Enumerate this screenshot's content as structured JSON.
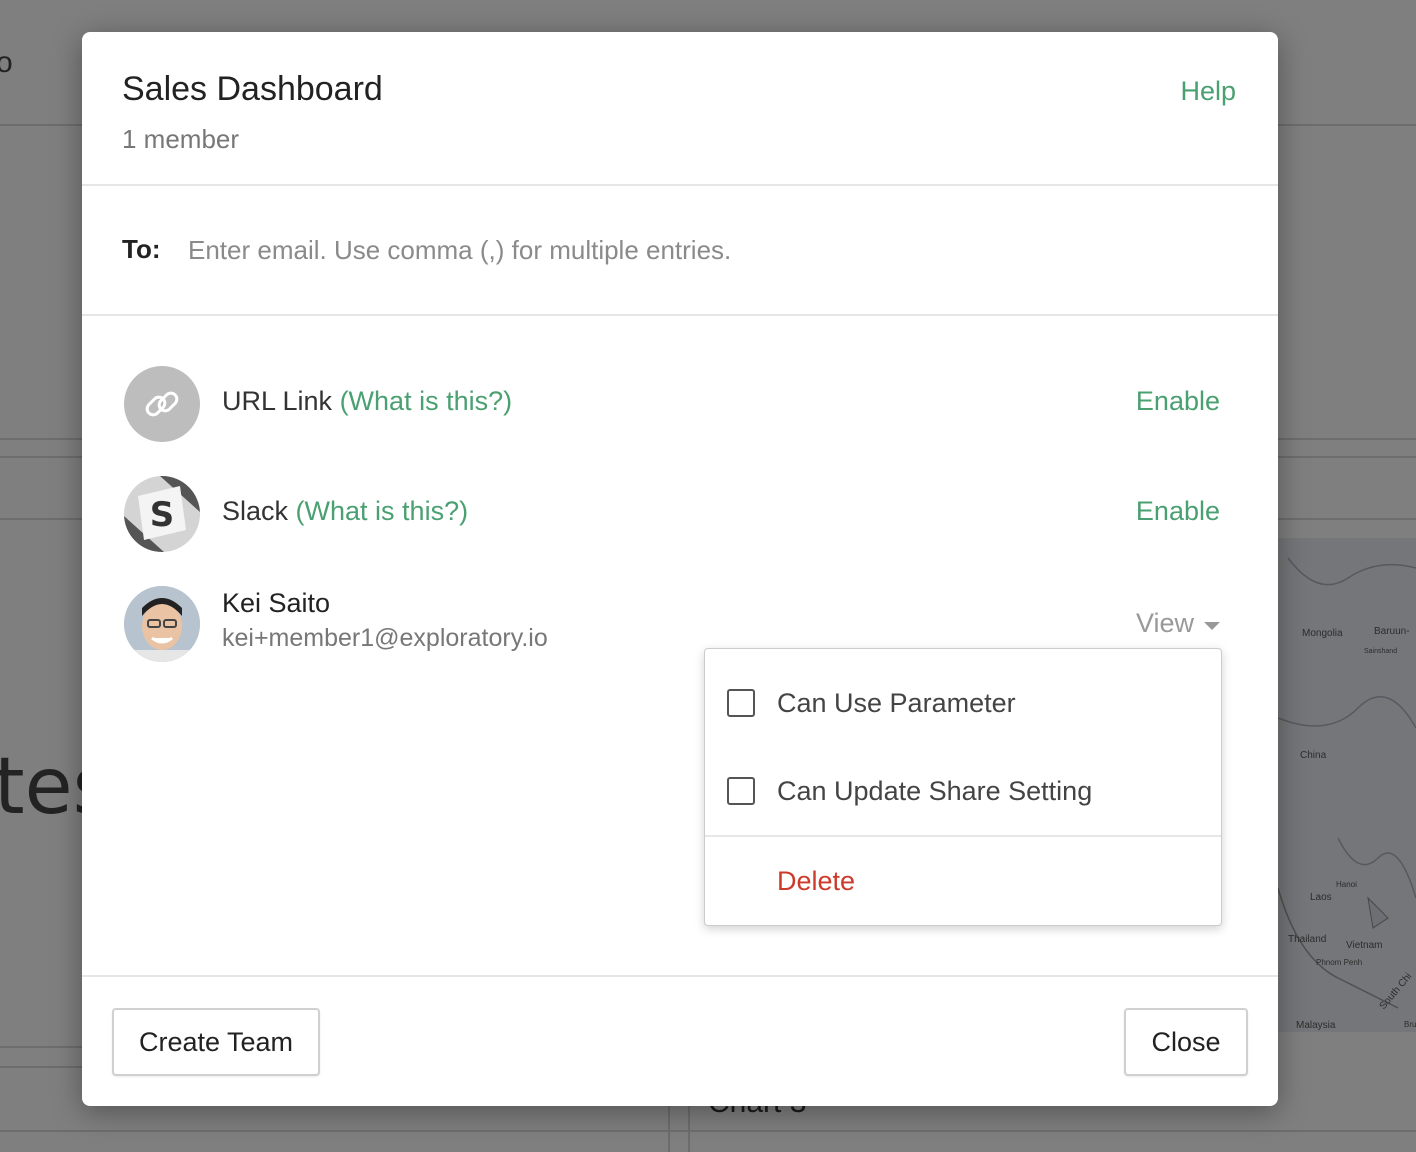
{
  "background": {
    "partial_heading": "tes",
    "partial_glyph": "o",
    "chart_label": "Chart 3",
    "map_labels": [
      "Mongolia",
      "Baruun-",
      "Sainshand",
      "China",
      "Laos",
      "Hanoi",
      "Thailand",
      "Vietnam",
      "Phnom Penh",
      "Malaysia",
      "South Chi",
      "Bru"
    ]
  },
  "modal": {
    "title": "Sales Dashboard",
    "subtitle": "1 member",
    "help_label": "Help"
  },
  "to_field": {
    "label": "To:",
    "placeholder": "Enter email. Use comma (,) for multiple entries.",
    "value": ""
  },
  "share_options": [
    {
      "name": "URL Link",
      "hint": "(What is this?)",
      "action": "Enable",
      "icon": "link-icon"
    },
    {
      "name": "Slack",
      "hint": "(What is this?)",
      "action": "Enable",
      "icon": "slack-icon"
    }
  ],
  "member": {
    "name": "Kei Saito",
    "email": "kei+member1@exploratory.io",
    "permission": "View",
    "icon": "avatar"
  },
  "dropdown": {
    "options": [
      {
        "label": "Can Use Parameter",
        "checked": false
      },
      {
        "label": "Can Update Share Setting",
        "checked": false
      }
    ],
    "delete_label": "Delete"
  },
  "footer": {
    "create_team_label": "Create Team",
    "close_label": "Close"
  },
  "colors": {
    "accent_green": "#4aa071",
    "danger_red": "#cc3a2a"
  }
}
